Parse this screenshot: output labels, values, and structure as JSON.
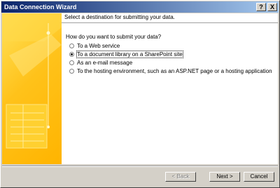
{
  "window": {
    "title": "Data Connection Wizard",
    "help_glyph": "?",
    "close_glyph": "X"
  },
  "main": {
    "heading": "Select a destination for submitting your data.",
    "question": "How do you want to submit your data?",
    "options": [
      {
        "label": "To a Web service",
        "selected": false
      },
      {
        "label": "To a document library on a SharePoint site",
        "selected": true
      },
      {
        "label": "As an e-mail message",
        "selected": false
      },
      {
        "label": "To the hosting environment, such as an ASP.NET page or a hosting application",
        "selected": false
      }
    ]
  },
  "buttons": {
    "back": "< Back",
    "next": "Next >",
    "cancel": "Cancel"
  },
  "colors": {
    "banner": "#ffc21a",
    "titlebar": "#0a246a"
  }
}
